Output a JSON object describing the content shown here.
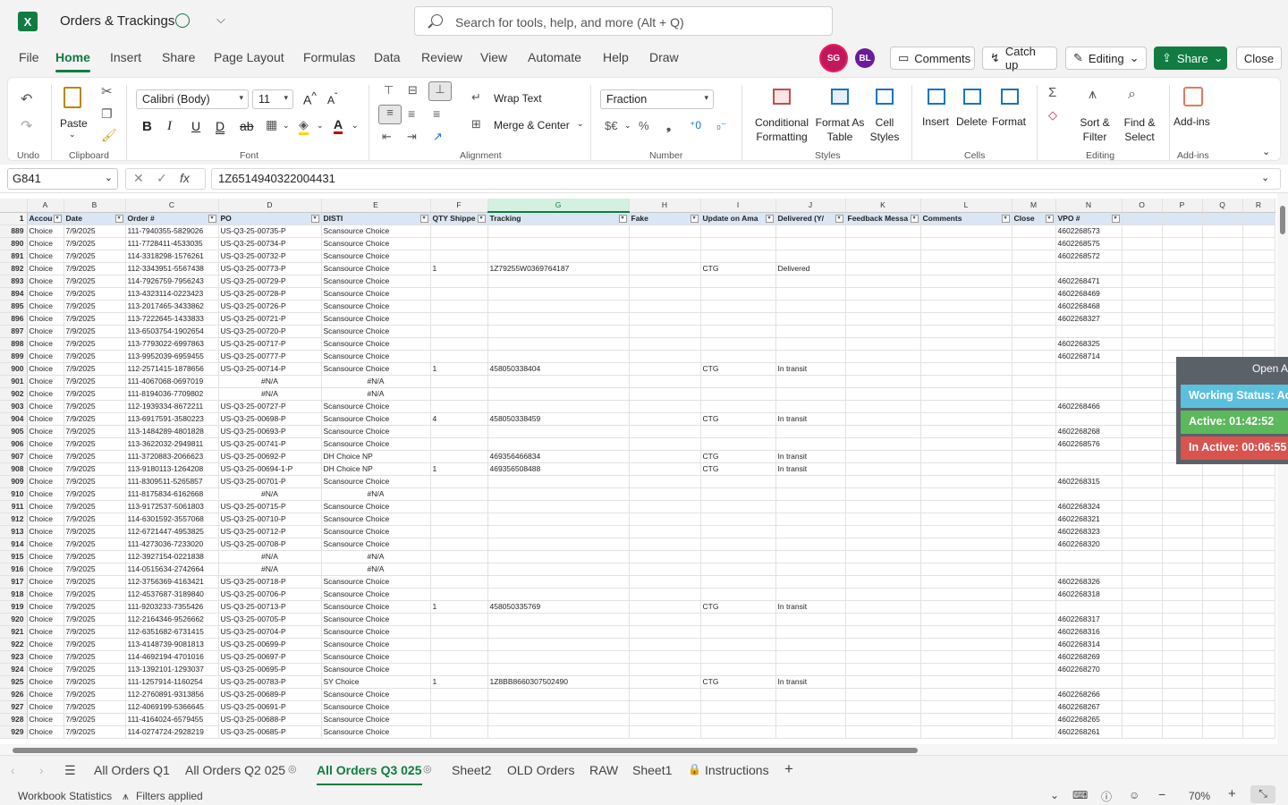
{
  "app": {
    "title": "Orders & Trackings",
    "logo": "X",
    "search_placeholder": "Search for tools, help, and more (Alt + Q)"
  },
  "menu": [
    "File",
    "Home",
    "Insert",
    "Share",
    "Page Layout",
    "Formulas",
    "Data",
    "Review",
    "View",
    "Automate",
    "Help",
    "Draw"
  ],
  "users": [
    "SG",
    "BL"
  ],
  "header_buttons": {
    "comments": "Comments",
    "catch_up": "Catch up",
    "editing": "Editing",
    "share": "Share",
    "close": "Close"
  },
  "ribbon": {
    "undo_label": "Undo",
    "paste": "Paste",
    "clipboard_label": "Clipboard",
    "font_name": "Calibri (Body)",
    "font_size": "11",
    "font_label": "Font",
    "wrap_text": "Wrap Text",
    "merge_center": "Merge & Center",
    "alignment_label": "Alignment",
    "number_format": "Fraction",
    "number_label": "Number",
    "conditional": "Conditional Formatting",
    "format_as_table": "Format As Table",
    "cell_styles": "Cell Styles",
    "styles_label": "Styles",
    "insert": "Insert",
    "delete": "Delete",
    "format": "Format",
    "cells_label": "Cells",
    "sort_filter": "Sort & Filter",
    "find_select": "Find & Select",
    "editing_label": "Editing",
    "addins": "Add-ins",
    "addins_label": "Add-ins"
  },
  "formula_bar": {
    "name_box": "G841",
    "formula": "1Z6514940322004431"
  },
  "columns": [
    "A",
    "B",
    "C",
    "D",
    "E",
    "F",
    "G",
    "H",
    "I",
    "J",
    "K",
    "L",
    "M",
    "N",
    "O",
    "P",
    "Q",
    "R"
  ],
  "header_row_num": "1",
  "headers": [
    "Accou",
    "Date",
    "Order #",
    "PO",
    "DISTI",
    "QTY Shippe",
    "Tracking",
    "Fake",
    "Update on Ama",
    "Delivered (Y/",
    "Feedback Messa",
    "Comments",
    "Close",
    "VPO #",
    "",
    "",
    "",
    ""
  ],
  "rows": [
    [
      "889",
      "Choice",
      "7/9/2025",
      "111-7940355-5829026",
      "US-Q3-25-00735-P",
      "Scansource Choice",
      "",
      "",
      "",
      "",
      "",
      "",
      "",
      "",
      "4602268573"
    ],
    [
      "890",
      "Choice",
      "7/9/2025",
      "111-7728411-4533035",
      "US-Q3-25-00734-P",
      "Scansource Choice",
      "",
      "",
      "",
      "",
      "",
      "",
      "",
      "",
      "4602268575"
    ],
    [
      "891",
      "Choice",
      "7/9/2025",
      "114-3318298-1576261",
      "US-Q3-25-00732-P",
      "Scansource Choice",
      "",
      "",
      "",
      "",
      "",
      "",
      "",
      "",
      "4602268572"
    ],
    [
      "892",
      "Choice",
      "7/9/2025",
      "112-3343951-5567438",
      "US-Q3-25-00773-P",
      "Scansource Choice",
      "1",
      "1Z79255W0369764187",
      "",
      "CTG",
      "Delivered",
      "",
      "",
      "",
      ""
    ],
    [
      "893",
      "Choice",
      "7/9/2025",
      "114-7926759-7956243",
      "US-Q3-25-00729-P",
      "Scansource Choice",
      "",
      "",
      "",
      "",
      "",
      "",
      "",
      "",
      "4602268471"
    ],
    [
      "894",
      "Choice",
      "7/9/2025",
      "113-4323114-0223423",
      "US-Q3-25-00728-P",
      "Scansource Choice",
      "",
      "",
      "",
      "",
      "",
      "",
      "",
      "",
      "4602268469"
    ],
    [
      "895",
      "Choice",
      "7/9/2025",
      "113-2017465-3433862",
      "US-Q3-25-00726-P",
      "Scansource Choice",
      "",
      "",
      "",
      "",
      "",
      "",
      "",
      "",
      "4602268468"
    ],
    [
      "896",
      "Choice",
      "7/9/2025",
      "113-7222645-1433833",
      "US-Q3-25-00721-P",
      "Scansource Choice",
      "",
      "",
      "",
      "",
      "",
      "",
      "",
      "",
      "4602268327"
    ],
    [
      "897",
      "Choice",
      "7/9/2025",
      "113-6503754-1902654",
      "US-Q3-25-00720-P",
      "Scansource Choice",
      "",
      "",
      "",
      "",
      "",
      "",
      "",
      "",
      ""
    ],
    [
      "898",
      "Choice",
      "7/9/2025",
      "113-7793022-6997863",
      "US-Q3-25-00717-P",
      "Scansource Choice",
      "",
      "",
      "",
      "",
      "",
      "",
      "",
      "",
      "4602268325"
    ],
    [
      "899",
      "Choice",
      "7/9/2025",
      "113-9952039-6959455",
      "US-Q3-25-00777-P",
      "Scansource Choice",
      "",
      "",
      "",
      "",
      "",
      "",
      "",
      "",
      "4602268714"
    ],
    [
      "900",
      "Choice",
      "7/9/2025",
      "112-2571415-1878656",
      "US-Q3-25-00714-P",
      "Scansource Choice",
      "1",
      "458050338404",
      "",
      "CTG",
      "In transit",
      "",
      "",
      "",
      ""
    ],
    [
      "901",
      "Choice",
      "7/9/2025",
      "111-4067068-0697019",
      "#N/A",
      "#N/A",
      "",
      "",
      "",
      "",
      "",
      "",
      "",
      "",
      ""
    ],
    [
      "902",
      "Choice",
      "7/9/2025",
      "111-8194036-7709802",
      "#N/A",
      "#N/A",
      "",
      "",
      "",
      "",
      "",
      "",
      "",
      "",
      ""
    ],
    [
      "903",
      "Choice",
      "7/9/2025",
      "112-1939334-8672211",
      "US-Q3-25-00727-P",
      "Scansource Choice",
      "",
      "",
      "",
      "",
      "",
      "",
      "",
      "",
      "4602268466"
    ],
    [
      "904",
      "Choice",
      "7/9/2025",
      "113-6917591-3580223",
      "US-Q3-25-00698-P",
      "Scansource Choice",
      "4",
      "458050338459",
      "",
      "CTG",
      "In transit",
      "",
      "",
      "",
      ""
    ],
    [
      "905",
      "Choice",
      "7/9/2025",
      "113-1484289-4801828",
      "US-Q3-25-00693-P",
      "Scansource Choice",
      "",
      "",
      "",
      "",
      "",
      "",
      "",
      "",
      "4602268268"
    ],
    [
      "906",
      "Choice",
      "7/9/2025",
      "113-3622032-2949811",
      "US-Q3-25-00741-P",
      "Scansource Choice",
      "",
      "",
      "",
      "",
      "",
      "",
      "",
      "",
      "4602268576"
    ],
    [
      "907",
      "Choice",
      "7/9/2025",
      "111-3720883-2066623",
      "US-Q3-25-00692-P",
      "DH Choice NP",
      "",
      "469356466834",
      "",
      "CTG",
      "In transit",
      "",
      "",
      "",
      ""
    ],
    [
      "908",
      "Choice",
      "7/9/2025",
      "113-9180113-1264208",
      "US-Q3-25-00694-1-P",
      "DH Choice NP",
      "1",
      "469356508488",
      "",
      "CTG",
      "In transit",
      "",
      "",
      "",
      ""
    ],
    [
      "909",
      "Choice",
      "7/9/2025",
      "111-8309511-5265857",
      "US-Q3-25-00701-P",
      "Scansource Choice",
      "",
      "",
      "",
      "",
      "",
      "",
      "",
      "",
      "4602268315"
    ],
    [
      "910",
      "Choice",
      "7/9/2025",
      "111-8175834-6162668",
      "#N/A",
      "#N/A",
      "",
      "",
      "",
      "",
      "",
      "",
      "",
      "",
      ""
    ],
    [
      "911",
      "Choice",
      "7/9/2025",
      "113-9172537-5061803",
      "US-Q3-25-00715-P",
      "Scansource Choice",
      "",
      "",
      "",
      "",
      "",
      "",
      "",
      "",
      "4602268324"
    ],
    [
      "912",
      "Choice",
      "7/9/2025",
      "114-6301592-3557068",
      "US-Q3-25-00710-P",
      "Scansource Choice",
      "",
      "",
      "",
      "",
      "",
      "",
      "",
      "",
      "4602268321"
    ],
    [
      "913",
      "Choice",
      "7/9/2025",
      "112-6721447-4953825",
      "US-Q3-25-00712-P",
      "Scansource Choice",
      "",
      "",
      "",
      "",
      "",
      "",
      "",
      "",
      "4602268323"
    ],
    [
      "914",
      "Choice",
      "7/9/2025",
      "111-4273036-7233020",
      "US-Q3-25-00708-P",
      "Scansource Choice",
      "",
      "",
      "",
      "",
      "",
      "",
      "",
      "",
      "4602268320"
    ],
    [
      "915",
      "Choice",
      "7/9/2025",
      "112-3927154-0221838",
      "#N/A",
      "#N/A",
      "",
      "",
      "",
      "",
      "",
      "",
      "",
      "",
      ""
    ],
    [
      "916",
      "Choice",
      "7/9/2025",
      "114-0515634-2742664",
      "#N/A",
      "#N/A",
      "",
      "",
      "",
      "",
      "",
      "",
      "",
      "",
      ""
    ],
    [
      "917",
      "Choice",
      "7/9/2025",
      "112-3756369-4163421",
      "US-Q3-25-00718-P",
      "Scansource Choice",
      "",
      "",
      "",
      "",
      "",
      "",
      "",
      "",
      "4602268326"
    ],
    [
      "918",
      "Choice",
      "7/9/2025",
      "112-4537687-3189840",
      "US-Q3-25-00706-P",
      "Scansource Choice",
      "",
      "",
      "",
      "",
      "",
      "",
      "",
      "",
      "4602268318"
    ],
    [
      "919",
      "Choice",
      "7/9/2025",
      "111-9203233-7355426",
      "US-Q3-25-00713-P",
      "Scansource Choice",
      "1",
      "458050335769",
      "",
      "CTG",
      "In transit",
      "",
      "",
      "",
      ""
    ],
    [
      "920",
      "Choice",
      "7/9/2025",
      "112-2164346-9526662",
      "US-Q3-25-00705-P",
      "Scansource Choice",
      "",
      "",
      "",
      "",
      "",
      "",
      "",
      "",
      "4602268317"
    ],
    [
      "921",
      "Choice",
      "7/9/2025",
      "112-6351682-6731415",
      "US-Q3-25-00704-P",
      "Scansource Choice",
      "",
      "",
      "",
      "",
      "",
      "",
      "",
      "",
      "4602268316"
    ],
    [
      "922",
      "Choice",
      "7/9/2025",
      "113-4148739-9081813",
      "US-Q3-25-00699-P",
      "Scansource Choice",
      "",
      "",
      "",
      "",
      "",
      "",
      "",
      "",
      "4602268314"
    ],
    [
      "923",
      "Choice",
      "7/9/2025",
      "114-4692194-4701016",
      "US-Q3-25-00697-P",
      "Scansource Choice",
      "",
      "",
      "",
      "",
      "",
      "",
      "",
      "",
      "4602268269"
    ],
    [
      "924",
      "Choice",
      "7/9/2025",
      "113-1392101-1293037",
      "US-Q3-25-00695-P",
      "Scansource Choice",
      "",
      "",
      "",
      "",
      "",
      "",
      "",
      "",
      "4602268270"
    ],
    [
      "925",
      "Choice",
      "7/9/2025",
      "111-1257914-1160254",
      "US-Q3-25-00783-P",
      "SY Choice",
      "1",
      "1Z8BB8660307502490",
      "",
      "CTG",
      "In transit",
      "",
      "",
      "",
      ""
    ],
    [
      "926",
      "Choice",
      "7/9/2025",
      "112-2760891-9313856",
      "US-Q3-25-00689-P",
      "Scansource Choice",
      "",
      "",
      "",
      "",
      "",
      "",
      "",
      "",
      "4602268266"
    ],
    [
      "927",
      "Choice",
      "7/9/2025",
      "112-4069199-5366645",
      "US-Q3-25-00691-P",
      "Scansource Choice",
      "",
      "",
      "",
      "",
      "",
      "",
      "",
      "",
      "4602268267"
    ],
    [
      "928",
      "Choice",
      "7/9/2025",
      "111-4164024-6579455",
      "US-Q3-25-00688-P",
      "Scansource Choice",
      "",
      "",
      "",
      "",
      "",
      "",
      "",
      "",
      "4602268265"
    ],
    [
      "929",
      "Choice",
      "7/9/2025",
      "114-0274724-2928219",
      "US-Q3-25-00685-P",
      "Scansource Choice",
      "",
      "",
      "",
      "",
      "",
      "",
      "",
      "",
      "4602268261"
    ]
  ],
  "widget": {
    "open_label": "Open A",
    "status": "Working Status: Act",
    "active": "Active: 01:42:52",
    "inactive": "In Active: 00:06:55",
    "colors": {
      "status": "#5bc0de",
      "active": "#5cb85c",
      "inactive": "#d9534f"
    }
  },
  "sheet_tabs": [
    "All Orders Q1",
    "All Orders Q2 025",
    "All Orders Q3 025",
    "Sheet2",
    "OLD Orders",
    "RAW",
    "Sheet1",
    "Instructions"
  ],
  "active_tab": "All Orders Q3 025",
  "status_bar": {
    "workbook_stats": "Workbook Statistics",
    "filters": "Filters applied",
    "zoom": "70%"
  },
  "colors": {
    "accent": "#107c41",
    "header_fill": "#dbe6f4"
  }
}
